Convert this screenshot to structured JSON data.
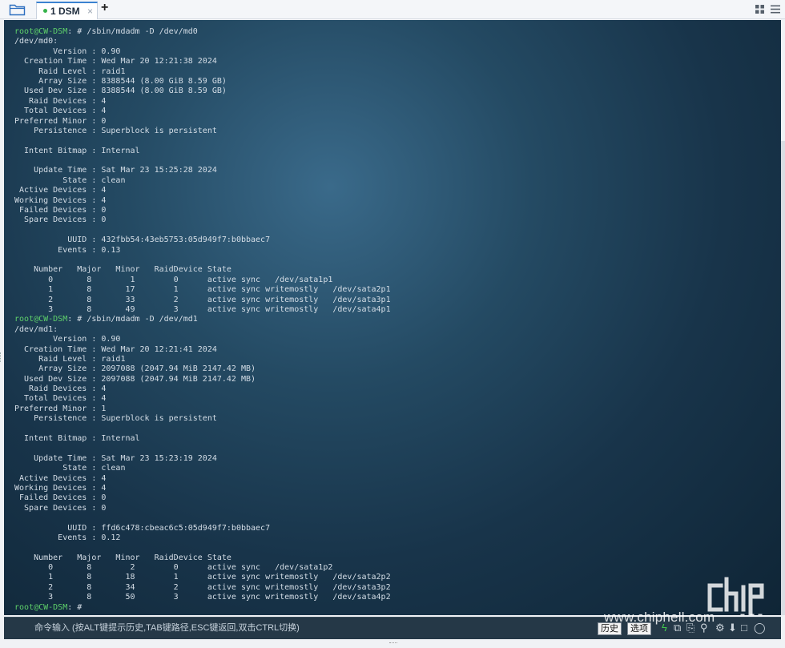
{
  "window": {
    "tab": {
      "label": "1 DSM",
      "close": "×"
    },
    "add_tab": "+"
  },
  "terminal": {
    "lines": [
      {
        "user": "root@CW-DSM",
        "rest": ": # /sbin/mdadm -D /dev/md0"
      },
      {
        "text": "/dev/md0:"
      },
      {
        "text": "        Version : 0.90"
      },
      {
        "text": "  Creation Time : Wed Mar 20 12:21:38 2024"
      },
      {
        "text": "     Raid Level : raid1"
      },
      {
        "text": "     Array Size : 8388544 (8.00 GiB 8.59 GB)"
      },
      {
        "text": "  Used Dev Size : 8388544 (8.00 GiB 8.59 GB)"
      },
      {
        "text": "   Raid Devices : 4"
      },
      {
        "text": "  Total Devices : 4"
      },
      {
        "text": "Preferred Minor : 0"
      },
      {
        "text": "    Persistence : Superblock is persistent"
      },
      {
        "text": ""
      },
      {
        "text": "  Intent Bitmap : Internal"
      },
      {
        "text": ""
      },
      {
        "text": "    Update Time : Sat Mar 23 15:25:28 2024"
      },
      {
        "text": "          State : clean"
      },
      {
        "text": " Active Devices : 4"
      },
      {
        "text": "Working Devices : 4"
      },
      {
        "text": " Failed Devices : 0"
      },
      {
        "text": "  Spare Devices : 0"
      },
      {
        "text": ""
      },
      {
        "text": "           UUID : 432fbb54:43eb5753:05d949f7:b0bbaec7"
      },
      {
        "text": "         Events : 0.13"
      },
      {
        "text": ""
      },
      {
        "text": "    Number   Major   Minor   RaidDevice State"
      },
      {
        "text": "       0       8        1        0      active sync   /dev/sata1p1"
      },
      {
        "text": "       1       8       17        1      active sync writemostly   /dev/sata2p1"
      },
      {
        "text": "       2       8       33        2      active sync writemostly   /dev/sata3p1"
      },
      {
        "text": "       3       8       49        3      active sync writemostly   /dev/sata4p1"
      },
      {
        "user": "root@CW-DSM",
        "rest": ": # /sbin/mdadm -D /dev/md1"
      },
      {
        "text": "/dev/md1:"
      },
      {
        "text": "        Version : 0.90"
      },
      {
        "text": "  Creation Time : Wed Mar 20 12:21:41 2024"
      },
      {
        "text": "     Raid Level : raid1"
      },
      {
        "text": "     Array Size : 2097088 (2047.94 MiB 2147.42 MB)"
      },
      {
        "text": "  Used Dev Size : 2097088 (2047.94 MiB 2147.42 MB)"
      },
      {
        "text": "   Raid Devices : 4"
      },
      {
        "text": "  Total Devices : 4"
      },
      {
        "text": "Preferred Minor : 1"
      },
      {
        "text": "    Persistence : Superblock is persistent"
      },
      {
        "text": ""
      },
      {
        "text": "  Intent Bitmap : Internal"
      },
      {
        "text": ""
      },
      {
        "text": "    Update Time : Sat Mar 23 15:23:19 2024"
      },
      {
        "text": "          State : clean"
      },
      {
        "text": " Active Devices : 4"
      },
      {
        "text": "Working Devices : 4"
      },
      {
        "text": " Failed Devices : 0"
      },
      {
        "text": "  Spare Devices : 0"
      },
      {
        "text": ""
      },
      {
        "text": "           UUID : ffd6c478:cbeac6c5:05d949f7:b0bbaec7"
      },
      {
        "text": "         Events : 0.12"
      },
      {
        "text": ""
      },
      {
        "text": "    Number   Major   Minor   RaidDevice State"
      },
      {
        "text": "       0       8        2        0      active sync   /dev/sata1p2"
      },
      {
        "text": "       1       8       18        1      active sync writemostly   /dev/sata2p2"
      },
      {
        "text": "       2       8       34        2      active sync writemostly   /dev/sata3p2"
      },
      {
        "text": "       3       8       50        3      active sync writemostly   /dev/sata4p2"
      },
      {
        "user": "root@CW-DSM",
        "rest": ": #"
      }
    ]
  },
  "command_bar": {
    "placeholder": "命令输入 (按ALT键提示历史,TAB键路径,ESC键返回,双击CTRL切换)",
    "history_button": "历史",
    "options_button": "选项"
  },
  "icons": {
    "folder": "folder-icon",
    "grid": "grid-icon",
    "menu": "menu-icon",
    "bolt": "lightning-icon",
    "copy": "copy-icon",
    "paste": "paste-icon",
    "search": "search-icon",
    "gear": "gear-icon",
    "down": "arrow-down-icon",
    "maximize": "maximize-icon",
    "stop": "stop-icon"
  },
  "colors": {
    "prompt_user": "#5ed06a",
    "terminal_text": "#d4dde6",
    "tab_accent": "#3b82d0",
    "status_dot": "#35b34a"
  },
  "watermark": {
    "text": "www.chiphell.com"
  }
}
